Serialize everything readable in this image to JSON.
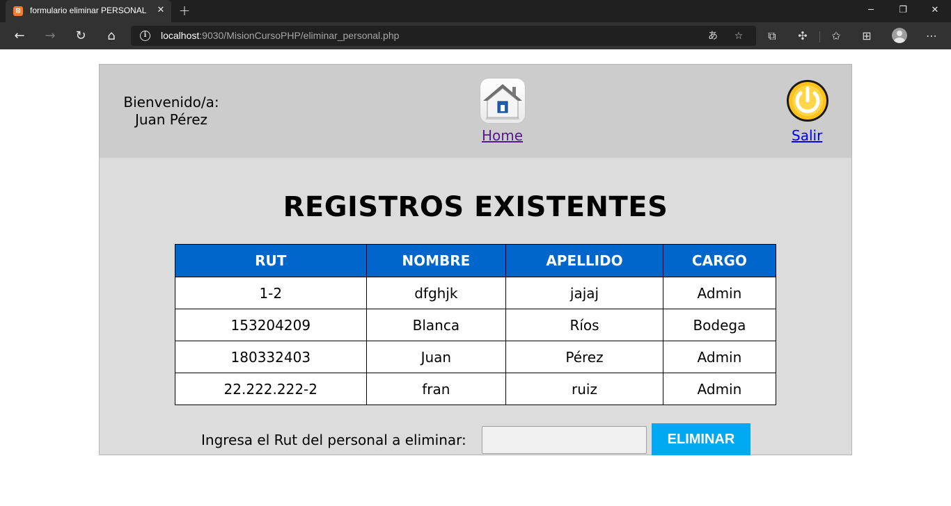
{
  "browser": {
    "tab_title": "formulario eliminar PERSONAL",
    "tab_favicon_text": "⊠",
    "url_host": "localhost",
    "url_rest": ":9030/MisionCursoPHP/eliminar_personal.php"
  },
  "header": {
    "welcome_line1": "Bienvenido/a:",
    "welcome_line2": "Juan Pérez",
    "home_label": "Home",
    "logout_label": "Salir"
  },
  "main": {
    "title": "REGISTROS EXISTENTES",
    "table": {
      "columns": [
        "RUT",
        "NOMBRE",
        "APELLIDO",
        "CARGO"
      ],
      "rows": [
        [
          "1-2",
          "dfghjk",
          "jajaj",
          "Admin"
        ],
        [
          "153204209",
          "Blanca",
          "Ríos",
          "Bodega"
        ],
        [
          "180332403",
          "Juan",
          "Pérez",
          "Admin"
        ],
        [
          "22.222.222-2",
          "fran",
          "ruiz",
          "Admin"
        ]
      ]
    },
    "form": {
      "label": "Ingresa el Rut del personal a eliminar:",
      "input_value": "",
      "button_label": "ELIMINAR"
    }
  },
  "colors": {
    "table_header": "#0066cc",
    "button": "#00a9f1",
    "header_band": "#cccccc",
    "content_bg": "#dcdcdc"
  }
}
